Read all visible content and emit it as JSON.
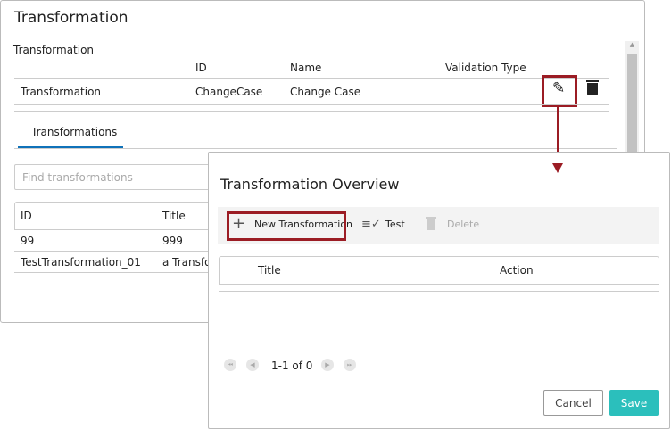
{
  "main": {
    "title": "Transformation",
    "section_label": "Transformation",
    "columns": [
      "ID",
      "Name",
      "Validation Type"
    ],
    "row": {
      "type": "Transformation",
      "id": "ChangeCase",
      "name": "Change Case",
      "validation_type": ""
    },
    "tab": "Transformations",
    "search_placeholder": "Find transformations",
    "table_columns": [
      "ID",
      "Title"
    ],
    "table_rows": [
      {
        "id": "99",
        "title": "999"
      },
      {
        "id": "TestTransformation_01",
        "title": "a Transfor"
      }
    ]
  },
  "dialog": {
    "title": "Transformation Overview",
    "toolbar": {
      "new": "New Transformation",
      "test": "Test",
      "delete": "Delete"
    },
    "columns": [
      "Title",
      "Action"
    ],
    "pagination": "1-1 of 0",
    "cancel": "Cancel",
    "save": "Save"
  },
  "colors": {
    "accent": "#0f72b9",
    "save": "#2bbfbc",
    "highlight": "#9b1c24"
  }
}
